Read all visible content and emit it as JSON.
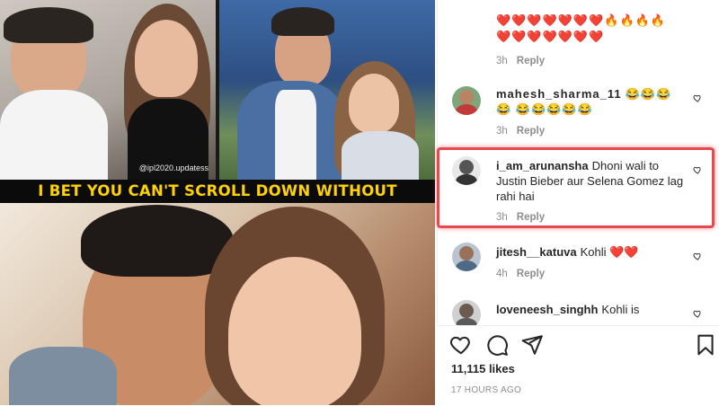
{
  "post": {
    "banner_text": "I BET YOU CAN'T SCROLL DOWN WITHOUT",
    "watermark": "@ipl2020.updatess"
  },
  "comments": [
    {
      "username": "",
      "text": "❤️❤️❤️❤️❤️❤️❤️🔥🔥🔥🔥 ❤️❤️❤️❤️❤️❤️❤️",
      "time": "3h",
      "reply_label": "Reply"
    },
    {
      "username": "mahesh_sharma_11",
      "text": "😂😂😂😂 😂😂😂😂😂",
      "time": "3h",
      "reply_label": "Reply"
    },
    {
      "username": "i_am_arunansha",
      "text": "Dhoni wali to Justin Bieber aur Selena Gomez lag rahi hai",
      "time": "3h",
      "reply_label": "Reply"
    },
    {
      "username": "jitesh__katuva",
      "text": "Kohli ❤️❤️",
      "time": "4h",
      "reply_label": "Reply"
    },
    {
      "username": "loveneesh_singhh",
      "text": "Kohli is",
      "time": "",
      "reply_label": ""
    }
  ],
  "actions": {
    "like_icon": "heart-outline-icon",
    "comment_icon": "comment-bubble-icon",
    "share_icon": "paper-plane-icon",
    "save_icon": "bookmark-icon"
  },
  "likes_text": "11,115 likes",
  "time_ago": "17 HOURS AGO",
  "colors": {
    "highlight": "#e8494f",
    "banner_text": "#ffd200",
    "meta_gray": "#8e8e8e"
  }
}
